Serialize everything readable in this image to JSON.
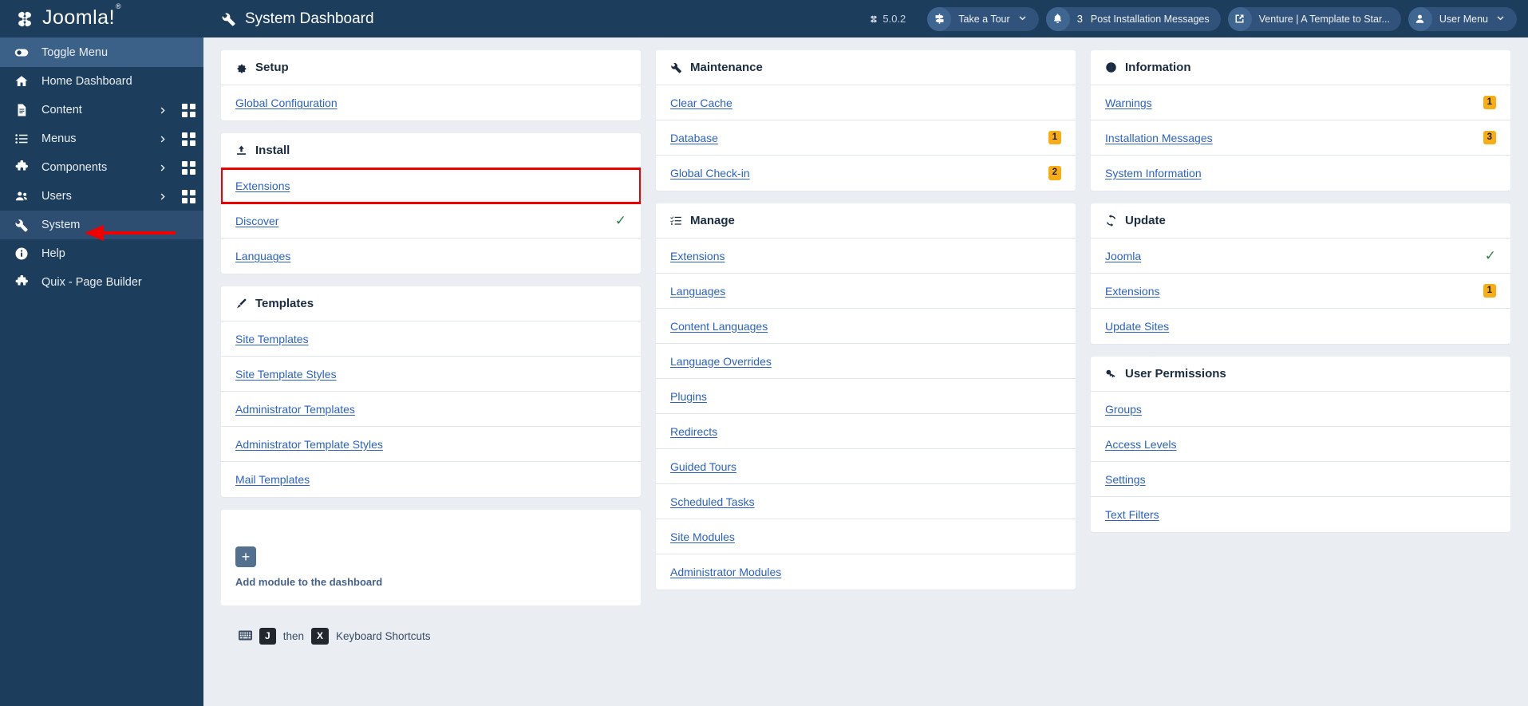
{
  "sidebar": {
    "brand": {
      "name": "Joomla!",
      "trademark": "®"
    },
    "items": [
      {
        "label": "Toggle Menu",
        "icon": "toggle-icon",
        "state": "toggle",
        "chevron": false,
        "grid": false
      },
      {
        "label": "Home Dashboard",
        "icon": "home-icon",
        "state": "normal",
        "chevron": false,
        "grid": false
      },
      {
        "label": "Content",
        "icon": "document-icon",
        "state": "normal",
        "chevron": true,
        "grid": true
      },
      {
        "label": "Menus",
        "icon": "list-icon",
        "state": "normal",
        "chevron": true,
        "grid": true
      },
      {
        "label": "Components",
        "icon": "puzzle-icon",
        "state": "normal",
        "chevron": true,
        "grid": true
      },
      {
        "label": "Users",
        "icon": "users-icon",
        "state": "normal",
        "chevron": true,
        "grid": true
      },
      {
        "label": "System",
        "icon": "wrench-icon",
        "state": "system",
        "chevron": false,
        "grid": false
      },
      {
        "label": "Help",
        "icon": "info-icon",
        "state": "normal",
        "chevron": false,
        "grid": false
      },
      {
        "label": "Quix - Page Builder",
        "icon": "puzzle-icon",
        "state": "normal",
        "chevron": false,
        "grid": false
      }
    ]
  },
  "topbar": {
    "title": "System Dashboard",
    "title_icon": "wrench-icon",
    "version": "5.0.2",
    "buttons": [
      {
        "label": "Take a Tour",
        "icon": "signpost-icon",
        "count": "",
        "caret": true,
        "name": "take-a-tour-button"
      },
      {
        "label": "Post Installation Messages",
        "icon": "bell-icon",
        "count": "3",
        "caret": false,
        "name": "post-installation-messages-button"
      },
      {
        "label": "Venture | A Template to Star...",
        "icon": "external-link-icon",
        "count": "",
        "caret": false,
        "name": "site-preview-button"
      },
      {
        "label": "User Menu",
        "icon": "user-icon",
        "count": "",
        "caret": true,
        "name": "user-menu-button"
      }
    ]
  },
  "panels": {
    "setup": {
      "title": "Setup",
      "icon": "gear-icon",
      "items": [
        {
          "label": "Global Configuration",
          "badge": "",
          "check": false,
          "highlight": false
        }
      ]
    },
    "install": {
      "title": "Install",
      "icon": "upload-icon",
      "items": [
        {
          "label": "Extensions",
          "badge": "",
          "check": false,
          "highlight": true
        },
        {
          "label": "Discover",
          "badge": "",
          "check": true,
          "highlight": false
        },
        {
          "label": "Languages",
          "badge": "",
          "check": false,
          "highlight": false
        }
      ]
    },
    "templates": {
      "title": "Templates",
      "icon": "brush-icon",
      "items": [
        {
          "label": "Site Templates",
          "badge": "",
          "check": false,
          "highlight": false
        },
        {
          "label": "Site Template Styles",
          "badge": "",
          "check": false,
          "highlight": false
        },
        {
          "label": "Administrator Templates",
          "badge": "",
          "check": false,
          "highlight": false
        },
        {
          "label": "Administrator Template Styles",
          "badge": "",
          "check": false,
          "highlight": false
        },
        {
          "label": "Mail Templates",
          "badge": "",
          "check": false,
          "highlight": false
        }
      ]
    },
    "maintenance": {
      "title": "Maintenance",
      "icon": "wrench-icon",
      "items": [
        {
          "label": "Clear Cache",
          "badge": "",
          "check": false,
          "highlight": false
        },
        {
          "label": "Database",
          "badge": "1",
          "check": false,
          "highlight": false
        },
        {
          "label": "Global Check-in",
          "badge": "2",
          "check": false,
          "highlight": false
        }
      ]
    },
    "manage": {
      "title": "Manage",
      "icon": "checklist-icon",
      "items": [
        {
          "label": "Extensions",
          "badge": "",
          "check": false,
          "highlight": false
        },
        {
          "label": "Languages",
          "badge": "",
          "check": false,
          "highlight": false
        },
        {
          "label": "Content Languages",
          "badge": "",
          "check": false,
          "highlight": false
        },
        {
          "label": "Language Overrides",
          "badge": "",
          "check": false,
          "highlight": false
        },
        {
          "label": "Plugins",
          "badge": "",
          "check": false,
          "highlight": false
        },
        {
          "label": "Redirects",
          "badge": "",
          "check": false,
          "highlight": false
        },
        {
          "label": "Guided Tours",
          "badge": "",
          "check": false,
          "highlight": false
        },
        {
          "label": "Scheduled Tasks",
          "badge": "",
          "check": false,
          "highlight": false
        },
        {
          "label": "Site Modules",
          "badge": "",
          "check": false,
          "highlight": false
        },
        {
          "label": "Administrator Modules",
          "badge": "",
          "check": false,
          "highlight": false
        }
      ]
    },
    "information": {
      "title": "Information",
      "icon": "info-icon",
      "items": [
        {
          "label": "Warnings",
          "badge": "1",
          "check": false,
          "highlight": false
        },
        {
          "label": "Installation Messages",
          "badge": "3",
          "check": false,
          "highlight": false
        },
        {
          "label": "System Information",
          "badge": "",
          "check": false,
          "highlight": false
        }
      ]
    },
    "update": {
      "title": "Update",
      "icon": "refresh-icon",
      "items": [
        {
          "label": "Joomla",
          "badge": "",
          "check": true,
          "highlight": false
        },
        {
          "label": "Extensions",
          "badge": "1",
          "check": false,
          "highlight": false
        },
        {
          "label": "Update Sites",
          "badge": "",
          "check": false,
          "highlight": false
        }
      ]
    },
    "user_permissions": {
      "title": "User Permissions",
      "icon": "key-icon",
      "items": [
        {
          "label": "Groups",
          "badge": "",
          "check": false,
          "highlight": false
        },
        {
          "label": "Access Levels",
          "badge": "",
          "check": false,
          "highlight": false
        },
        {
          "label": "Settings",
          "badge": "",
          "check": false,
          "highlight": false
        },
        {
          "label": "Text Filters",
          "badge": "",
          "check": false,
          "highlight": false
        }
      ]
    }
  },
  "add_module": {
    "plus": "+",
    "label": "Add module to the dashboard"
  },
  "footer": {
    "key1": "J",
    "then": "then",
    "key2": "X",
    "label": "Keyboard Shortcuts"
  },
  "colors": {
    "sidebar_bg": "#1c3d5c",
    "sidebar_active": "#3c6189",
    "link": "#2a62c4",
    "badge": "#f8ad15",
    "check": "#2e7d49",
    "annotation": "#ee0000",
    "page_bg": "#eaeef2"
  }
}
